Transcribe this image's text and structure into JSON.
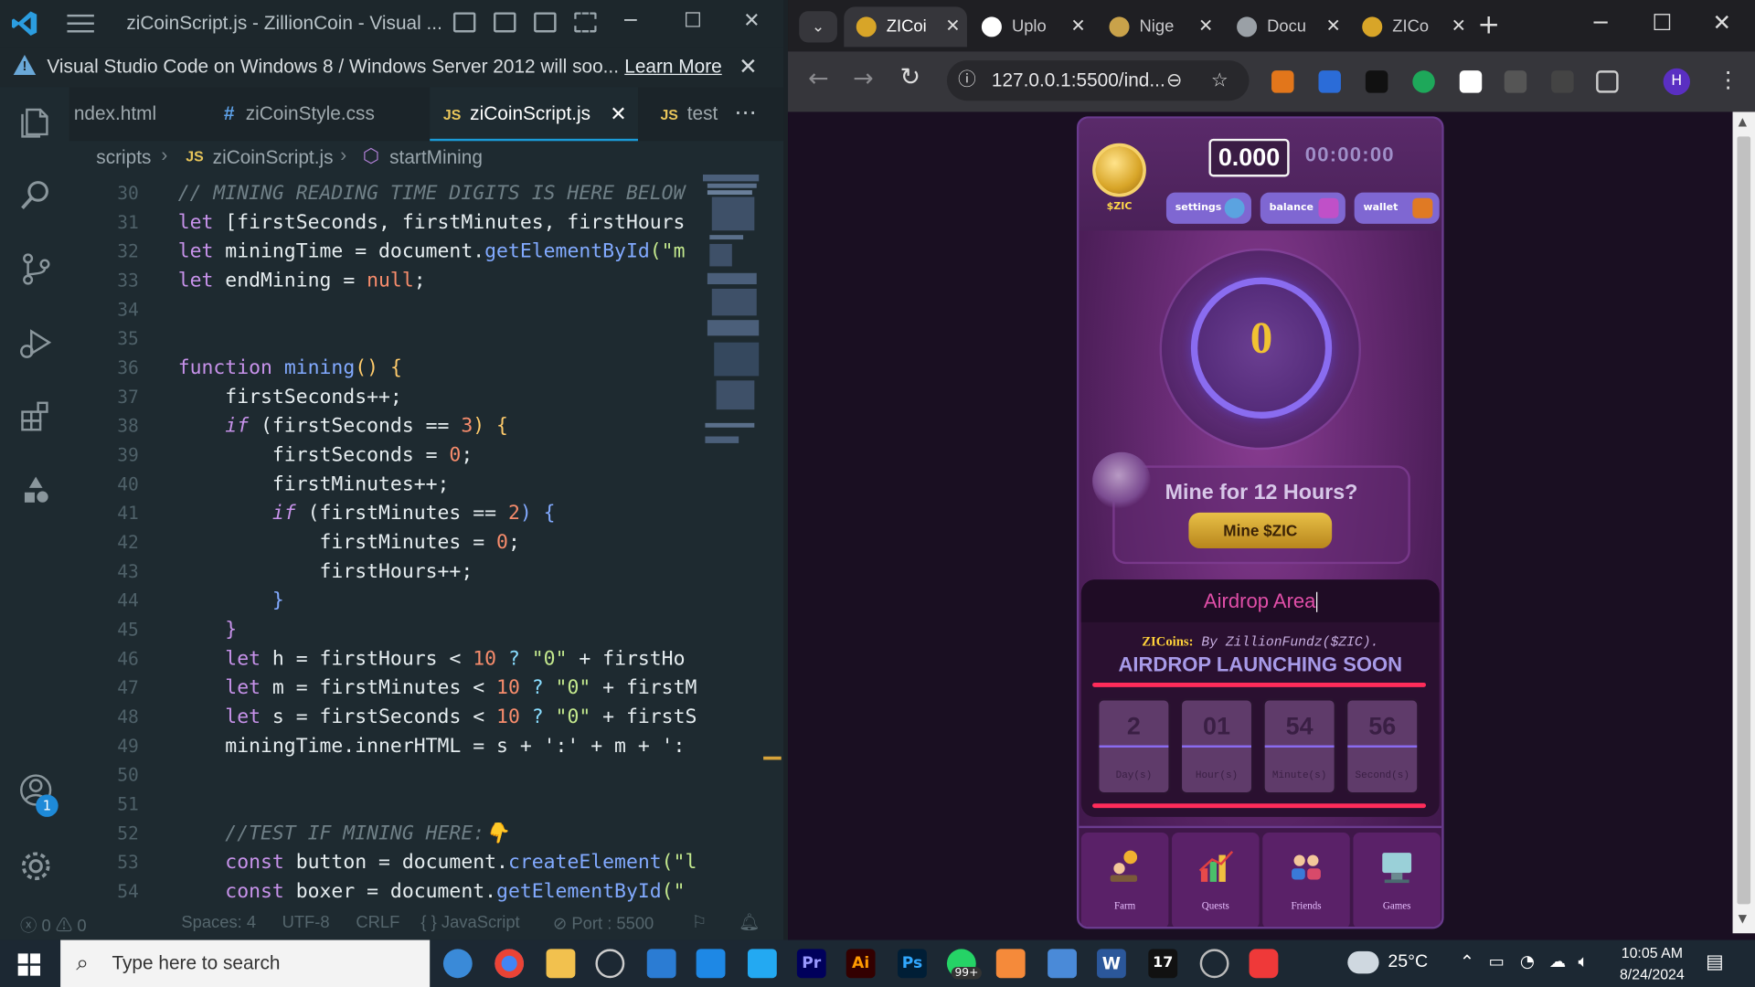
{
  "vscode": {
    "window_title": "ziCoinScript.js - ZillionCoin - Visual ...",
    "notification": {
      "message": "Visual Studio Code on Windows 8 / Windows Server 2012 will soo...",
      "learn_more": "Learn More"
    },
    "tabs": [
      {
        "label": "ndex.html",
        "kind": "html"
      },
      {
        "label": "ziCoinStyle.css",
        "kind": "css",
        "icon": "#"
      },
      {
        "label": "ziCoinScript.js",
        "kind": "js",
        "icon": "JS",
        "active": true
      },
      {
        "label": "test",
        "kind": "js",
        "icon": "JS"
      }
    ],
    "breadcrumb": {
      "folder": "scripts",
      "file_icon": "JS",
      "file": "ziCoinScript.js",
      "symbol": "startMining"
    },
    "line_numbers": [
      "30",
      "31",
      "32",
      "33",
      "34",
      "35",
      "36",
      "37",
      "38",
      "39",
      "40",
      "41",
      "42",
      "43",
      "44",
      "45",
      "46",
      "47",
      "48",
      "49",
      "50",
      "51",
      "52",
      "53",
      "54"
    ],
    "code": {
      "l30": "// MINING READING TIME DIGITS IS HERE BELOW",
      "l31a": "let",
      "l31b": " [firstSeconds, firstMinutes, firstHours",
      "l32a": "let",
      "l32b": " miningTime = document.",
      "l32c": "getElementById",
      "l32d": "(\"m",
      "l33a": "let",
      "l33b": " endMining = ",
      "l33c": "null",
      "l33d": ";",
      "l36a": "function",
      "l36b": " mining",
      "l36c": "() {",
      "l37": "    firstSeconds++;",
      "l38a": "    if",
      "l38b": " (firstSeconds == ",
      "l38c": "3",
      "l38d": ") {",
      "l39a": "        firstSeconds = ",
      "l39b": "0",
      "l39c": ";",
      "l40": "        firstMinutes++;",
      "l41a": "        if",
      "l41b": " (firstMinutes == ",
      "l41c": "2",
      "l41d": ") {",
      "l42a": "            firstMinutes = ",
      "l42b": "0",
      "l42c": ";",
      "l43": "            firstHours++;",
      "l44": "        }",
      "l45": "    }",
      "l46a": "    let",
      "l46b": " h = firstHours < ",
      "l46c": "10",
      "l46d": " ? ",
      "l46e": "\"0\"",
      "l46f": " + firstHo",
      "l47a": "    let",
      "l47b": " m = firstMinutes < ",
      "l47c": "10",
      "l47d": " ? ",
      "l47e": "\"0\"",
      "l47f": " + firstM",
      "l48a": "    let",
      "l48b": " s = firstSeconds < ",
      "l48c": "10",
      "l48d": " ? ",
      "l48e": "\"0\"",
      "l48f": " + firstS",
      "l49": "    miningTime.innerHTML = s + ':' + m + ':",
      "l52": "    //TEST IF MINING HERE:👇",
      "l53a": "    const",
      "l53b": " button = document.",
      "l53c": "createElement",
      "l53d": "(\"l",
      "l54a": "    const",
      "l54b": " boxer = document.",
      "l54c": "getElementById",
      "l54d": "(\""
    },
    "status": {
      "errors": "0",
      "warnings": "0",
      "spaces": "Spaces: 4",
      "encoding": "UTF-8",
      "eol": "CRLF",
      "language": "JavaScript",
      "port": "Port : 5500"
    },
    "accounts_badge": "1"
  },
  "browser": {
    "tabs": [
      {
        "label": "ZICoi",
        "active": true
      },
      {
        "label": "Uplo"
      },
      {
        "label": "Nige"
      },
      {
        "label": "Docu"
      },
      {
        "label": "ZICo"
      }
    ],
    "url": "127.0.0.1:5500/ind...",
    "profile_initial": "H"
  },
  "app": {
    "coin_symbol": "$ZIC",
    "balance": "0.000",
    "timer": "00:00:00",
    "buttons": {
      "settings": "settings",
      "balance": "balance",
      "wallet": "wallet"
    },
    "mine_counter": "0",
    "mine_question": "Mine for 12 Hours?",
    "mine_button": "Mine $ZIC",
    "airdrop": {
      "title": "Airdrop Area",
      "brand": "ZICoins:",
      "by": " By ZillionFundz($ZIC).",
      "soon": "AIRDROP LAUNCHING SOON",
      "countdown": [
        {
          "value": "2",
          "label": "Day(s)"
        },
        {
          "value": "01",
          "label": "Hour(s)"
        },
        {
          "value": "54",
          "label": "Minute(s)"
        },
        {
          "value": "56",
          "label": "Second(s)"
        }
      ]
    },
    "nav": [
      {
        "label": "Farm",
        "icon": "farm-icon"
      },
      {
        "label": "Quests",
        "icon": "chart-icon"
      },
      {
        "label": "Friends",
        "icon": "friends-icon"
      },
      {
        "label": "Games",
        "icon": "games-icon"
      }
    ],
    "colors": {
      "gold": "#f1c232",
      "accent": "#8a6cf0",
      "airdrop_title": "#e04ea8"
    }
  },
  "taskbar": {
    "search_placeholder": "Type here to search",
    "badge_count": "99+",
    "temperature": "25°C",
    "time": "10:05 AM",
    "date": "8/24/2024"
  }
}
